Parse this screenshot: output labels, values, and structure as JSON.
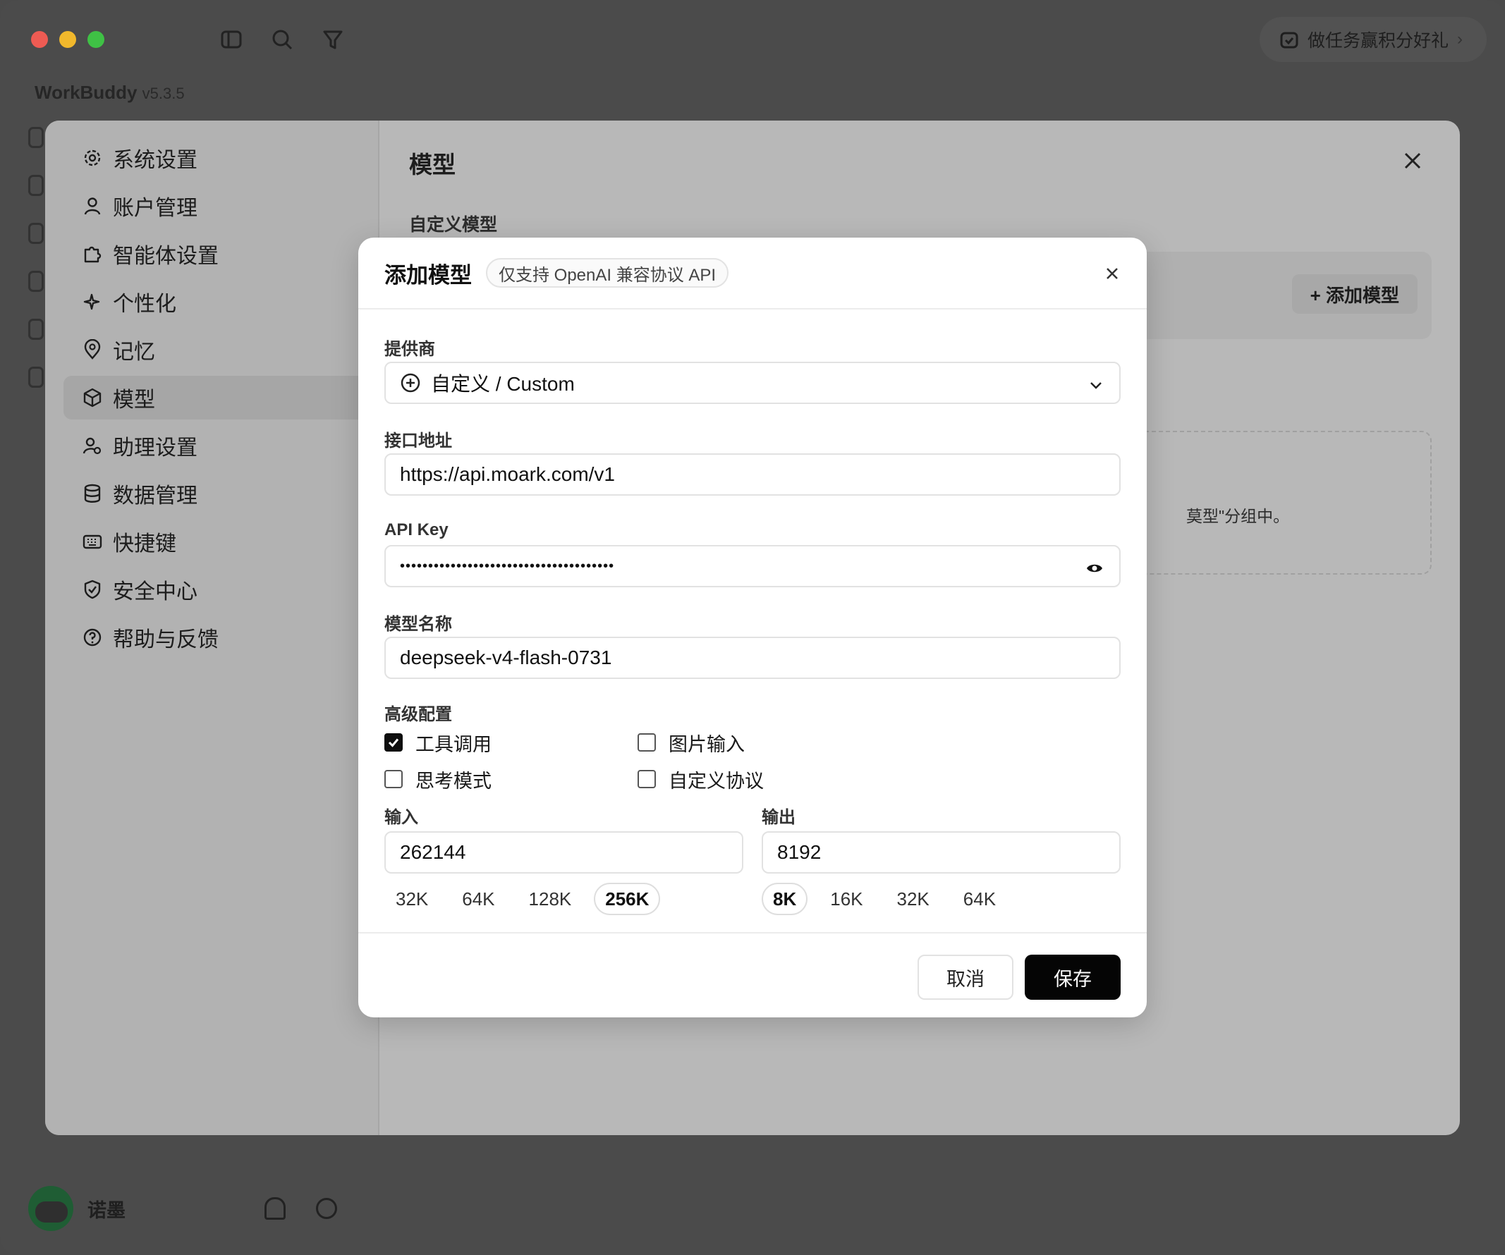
{
  "app": {
    "name": "WorkBuddy",
    "version": "v5.3.5",
    "task_pill": "做任务赢积分好礼",
    "user": "诺墨"
  },
  "settings": {
    "nav": [
      {
        "label": "系统设置",
        "icon": "gear-icon"
      },
      {
        "label": "账户管理",
        "icon": "user-icon"
      },
      {
        "label": "智能体设置",
        "icon": "puzzle-icon"
      },
      {
        "label": "个性化",
        "icon": "sparkle-icon"
      },
      {
        "label": "记忆",
        "icon": "brain-pin-icon"
      },
      {
        "label": "模型",
        "icon": "cube-icon",
        "active": true
      },
      {
        "label": "助理设置",
        "icon": "user-gear-icon"
      },
      {
        "label": "数据管理",
        "icon": "database-icon"
      },
      {
        "label": "快捷键",
        "icon": "keyboard-icon"
      },
      {
        "label": "安全中心",
        "icon": "shield-icon"
      },
      {
        "label": "帮助与反馈",
        "icon": "help-icon"
      }
    ],
    "main_title": "模型",
    "section_title": "自定义模型",
    "add_model_label": "+ 添加模型",
    "empty_hint_fragment": "莫型\"分组中。"
  },
  "modal": {
    "title": "添加模型",
    "tag": "仅支持 OpenAI 兼容协议 API",
    "provider_label": "提供商",
    "provider_value": "自定义 / Custom",
    "endpoint_label": "接口地址",
    "endpoint_value": "https://api.moark.com/v1",
    "apikey_label": "API Key",
    "apikey_value": "••••••••••••••••••••••••••••••••••••••",
    "model_name_label": "模型名称",
    "model_name_value": "deepseek-v4-flash-0731",
    "advanced_label": "高级配置",
    "options": [
      {
        "label": "工具调用",
        "checked": true
      },
      {
        "label": "图片输入",
        "checked": false
      },
      {
        "label": "思考模式",
        "checked": false
      },
      {
        "label": "自定义协议",
        "checked": false
      }
    ],
    "input_label": "输入",
    "input_value": "262144",
    "input_chips": [
      {
        "label": "32K",
        "active": false
      },
      {
        "label": "64K",
        "active": false
      },
      {
        "label": "128K",
        "active": false
      },
      {
        "label": "256K",
        "active": true
      }
    ],
    "output_label": "输出",
    "output_value": "8192",
    "output_chips": [
      {
        "label": "8K",
        "active": true
      },
      {
        "label": "16K",
        "active": false
      },
      {
        "label": "32K",
        "active": false
      },
      {
        "label": "64K",
        "active": false
      }
    ],
    "cancel_label": "取消",
    "save_label": "保存"
  }
}
